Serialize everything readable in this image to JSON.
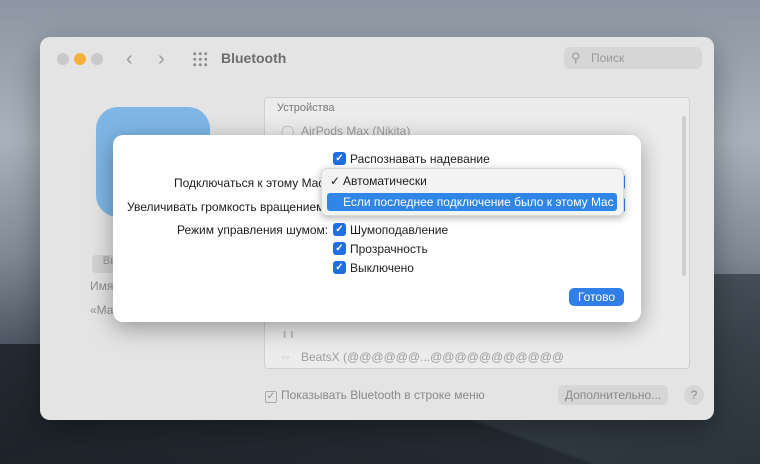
{
  "window": {
    "title": "Bluetooth",
    "search_placeholder": "Поиск",
    "devices_header": "Устройства",
    "devices": [
      {
        "name": "AirPods Max (Nikita)",
        "status": ""
      },
      {
        "name": "",
        "status": ""
      },
      {
        "name": "BeatsX (@@@@@@...@@@@@@@@@@@",
        "status": ""
      }
    ],
    "left_partial": {
      "button": "Вы",
      "name_label": "Имя",
      "quote": "«Ма"
    },
    "show_in_menubar": "Показывать Bluetooth в строке меню",
    "advanced_button": "Дополнительно...",
    "help_button": "?"
  },
  "sheet": {
    "ear_detection": "Распознавать надевание",
    "connect_label": "Подключаться к этому Mac",
    "volume_label": "Увеличивать громкость вращением",
    "noise_label": "Режим управления шумом:",
    "noise_options": [
      "Шумоподавление",
      "Прозрачность",
      "Выключено"
    ],
    "popup_options": [
      "Автоматически",
      "Если последнее подключение было к этому Mac"
    ],
    "popup_checkmark": "✓",
    "done_button": "Готово"
  }
}
